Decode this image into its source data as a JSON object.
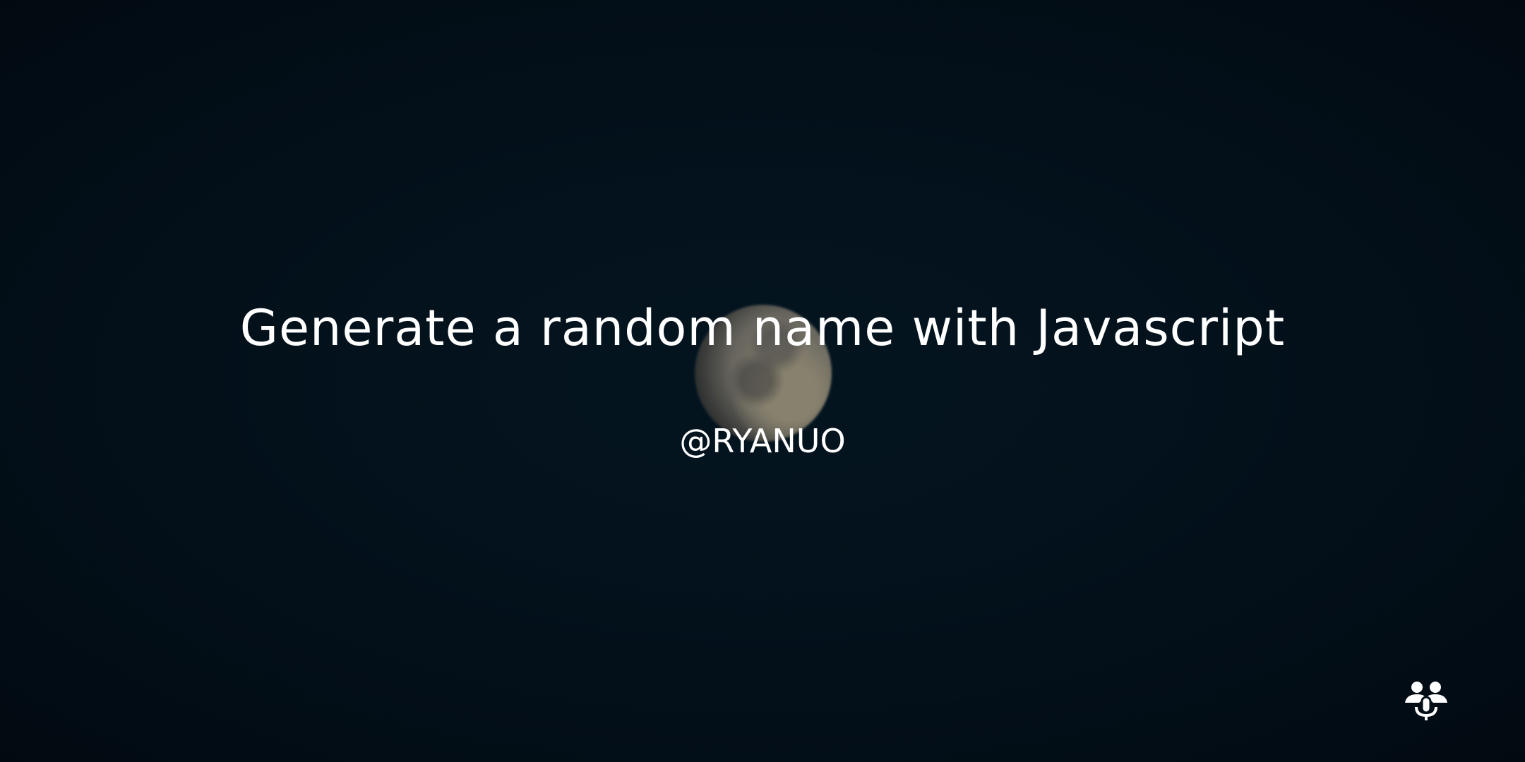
{
  "title": "Generate a random name with Javascript",
  "author_handle": "@RYANUO",
  "icons": {
    "corner": "people-microphone-icon",
    "background": "moon-image"
  }
}
